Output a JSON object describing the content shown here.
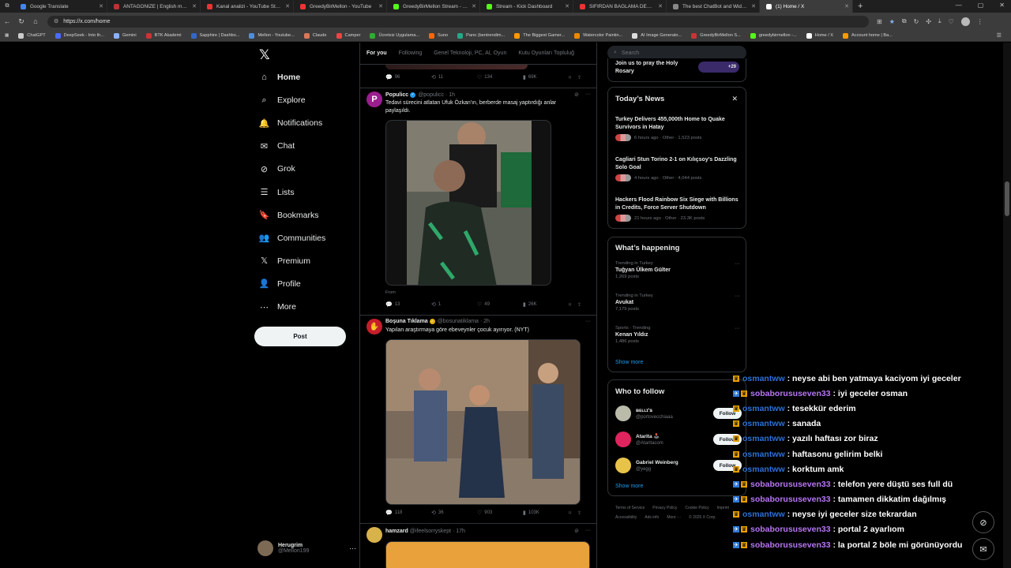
{
  "browser": {
    "tabs": [
      {
        "title": "Google Translate",
        "color": "#4285f4"
      },
      {
        "title": "ANTAGONIZE | English meaning - ",
        "color": "#b33"
      },
      {
        "title": "Kanal analizi - YouTube Studio",
        "color": "#e33"
      },
      {
        "title": "GreedyBirMellon - YouTube",
        "color": "#e33"
      },
      {
        "title": "GreedyBirMellon Stream - Watch L",
        "color": "#53fc18"
      },
      {
        "title": "Stream - Kick Dashboard",
        "color": "#53fc18"
      },
      {
        "title": "SIFIRDAN BAĞLAMA DERSİ 3 (EN",
        "color": "#e33"
      },
      {
        "title": "The best ChatBot and Widgets for",
        "color": "#888"
      },
      {
        "title": "(1) Home / X",
        "color": "#fff"
      }
    ],
    "url": "https://x.com/home",
    "bookmarks": [
      {
        "label": "ChatGPT",
        "color": "#ccc"
      },
      {
        "label": "DeepSeek - Into th...",
        "color": "#4d6bfe"
      },
      {
        "label": "Gemini",
        "color": "#8ab4f8"
      },
      {
        "label": "BTK Akademi",
        "color": "#c33"
      },
      {
        "label": "Sapphire | Dashbo...",
        "color": "#36c"
      },
      {
        "label": "Mellon - Youtube...",
        "color": "#4a90e2"
      },
      {
        "label": "Claude",
        "color": "#d97757"
      },
      {
        "label": "Camper",
        "color": "#e44"
      },
      {
        "label": "Ücretsiz Uygulama...",
        "color": "#3a3"
      },
      {
        "label": "Suno",
        "color": "#f60"
      },
      {
        "label": "Pano (bentrendim...",
        "color": "#2a8"
      },
      {
        "label": "The Biggest Gamer...",
        "color": "#f90"
      },
      {
        "label": "Watercolor Paintin...",
        "color": "#e80"
      },
      {
        "label": "AI Image Generato...",
        "color": "#ddd"
      },
      {
        "label": "GreedyBirMellon S...",
        "color": "#c33"
      },
      {
        "label": "greedybirmellon -...",
        "color": "#53fc18"
      },
      {
        "label": "Home / X",
        "color": "#fff"
      },
      {
        "label": "Account home | Ba...",
        "color": "#f90"
      }
    ],
    "all_bookmarks_label": "☰"
  },
  "nav": {
    "items": [
      {
        "label": "Home",
        "icon": "home-icon",
        "glyph": "⌂"
      },
      {
        "label": "Explore",
        "icon": "search-icon",
        "glyph": "⌕"
      },
      {
        "label": "Notifications",
        "icon": "bell-icon",
        "glyph": "🔔"
      },
      {
        "label": "Chat",
        "icon": "mail-icon",
        "glyph": "✉"
      },
      {
        "label": "Grok",
        "icon": "grok-icon",
        "glyph": "⊘"
      },
      {
        "label": "Lists",
        "icon": "list-icon",
        "glyph": "☰"
      },
      {
        "label": "Bookmarks",
        "icon": "bookmark-icon",
        "glyph": "🔖"
      },
      {
        "label": "Communities",
        "icon": "people-icon",
        "glyph": "👥"
      },
      {
        "label": "Premium",
        "icon": "x-icon",
        "glyph": "𝕏"
      },
      {
        "label": "Profile",
        "icon": "person-icon",
        "glyph": "👤"
      },
      {
        "label": "More",
        "icon": "more-icon",
        "glyph": "⋯"
      }
    ],
    "post_label": "Post",
    "user": {
      "name": "Herugrim",
      "handle": "@Mellon199"
    }
  },
  "feed": {
    "tabs": [
      "For you",
      "Following",
      "Genel Teknoloji, PC, AI, Oyun",
      "Kutu Oyunları Topluluğ"
    ],
    "top_actions": {
      "replies": "96",
      "reposts": "11",
      "likes": "134",
      "views": "69K"
    },
    "tweets": [
      {
        "name": "Populicc",
        "handle": "@populicc · 1h",
        "text": "Tedavi sürecini atlatan Ufuk Özkan'ın, berberde masaj yaptırdığı anlar paylaşıldı.",
        "from": "From",
        "replies": "13",
        "reposts": "1",
        "likes": "49",
        "views": "26K"
      },
      {
        "name": "Boşuna Tıklama",
        "handle": "@bosunatiklama · 2h",
        "text": "Yapılan araştırmaya göre ebeveynler çocuk ayırıyor. (NYT)",
        "replies": "118",
        "reposts": "36",
        "likes": "903",
        "views": "103K"
      },
      {
        "name": "hamzard",
        "handle": "@ifeelsorryskept · 17h",
        "text": ""
      }
    ]
  },
  "right": {
    "search_placeholder": "Search",
    "event_text": "Join us to pray the Holy Rosary",
    "event_count": "+29",
    "news_title": "Today’s News",
    "news": [
      {
        "title": "Turkey Delivers 455,000th Home to Quake Survivors in Hatay",
        "meta": "6 hours ago · Other · 1,523 posts"
      },
      {
        "title": "Cagliari Stun Torino 2-1 on Kılıçsoy's Dazzling Solo Goal",
        "meta": "4 hours ago · Other · 4,044 posts"
      },
      {
        "title": "Hackers Flood Rainbow Six Siege with Billions in Credits, Force Server Shutdown",
        "meta": "21 hours ago · Other · 23.3K posts"
      }
    ],
    "happening_title": "What’s happening",
    "trends": [
      {
        "context": "Trending in Turkey",
        "name": "Tuğyan Ülkem Gülter",
        "posts": "1,269 posts"
      },
      {
        "context": "Trending in Turkey",
        "name": "Avukat",
        "posts": "7,179 posts"
      },
      {
        "context": "Sports · Trending",
        "name": "Kenan Yıldız",
        "posts": "1,486 posts"
      }
    ],
    "show_more": "Show more",
    "who_title": "Who to follow",
    "follow_label": "Follow",
    "who": [
      {
        "name": "ʙᴇʟʟɪ'ꜱ",
        "handle": "@portovecchiaaa",
        "color": "#bba"
      },
      {
        "name": "Atarita 🕹️",
        "handle": "@Ataritacom",
        "color": "#e0245e"
      },
      {
        "name": "Gabriel Weinberg",
        "handle": "@yegg",
        "color": "#e8c34a"
      }
    ],
    "footer": [
      "Terms of Service",
      "Privacy Policy",
      "Cookie Policy",
      "Imprint",
      "Accessibility",
      "Ads info",
      "More ···",
      "© 2025 X Corp."
    ]
  },
  "chat": {
    "messages": [
      {
        "badge": "b3",
        "user": "osmantww",
        "color": "#2e6fd6",
        "text": "neyse abi ben yatmaya kaciyom iyi geceler"
      },
      {
        "badge": "b2",
        "user": "sobaborususeven33",
        "color": "#b675f5",
        "text": "iyi geceler osman"
      },
      {
        "badge": "b3",
        "user": "osmantww",
        "color": "#2e6fd6",
        "text": "tesekkür ederim"
      },
      {
        "badge": "b3",
        "user": "osmantww",
        "color": "#2e6fd6",
        "text": "sanada"
      },
      {
        "badge": "b3",
        "user": "osmantww",
        "color": "#2e6fd6",
        "text": "yazılı haftası zor biraz"
      },
      {
        "badge": "b3",
        "user": "osmantww",
        "color": "#2e6fd6",
        "text": "haftasonu gelirim belki"
      },
      {
        "badge": "b3",
        "user": "osmantww",
        "color": "#2e6fd6",
        "text": "korktum amk"
      },
      {
        "badge": "b2",
        "user": "sobaborususeven33",
        "color": "#b675f5",
        "text": "telefon yere düştü ses full dü"
      },
      {
        "badge": "b2",
        "user": "sobaborususeven33",
        "color": "#b675f5",
        "text": "tamamen dikkatim dağılmış"
      },
      {
        "badge": "b3",
        "user": "osmantww",
        "color": "#2e6fd6",
        "text": "neyse iyi geceler size tekrardan"
      },
      {
        "badge": "b2",
        "user": "sobaborususeven33",
        "color": "#b675f5",
        "text": "portal 2 ayarlıom"
      },
      {
        "badge": "b2",
        "user": "sobaborususeven33",
        "color": "#b675f5",
        "text": "la portal 2 böle mi görünüyordu"
      }
    ]
  }
}
